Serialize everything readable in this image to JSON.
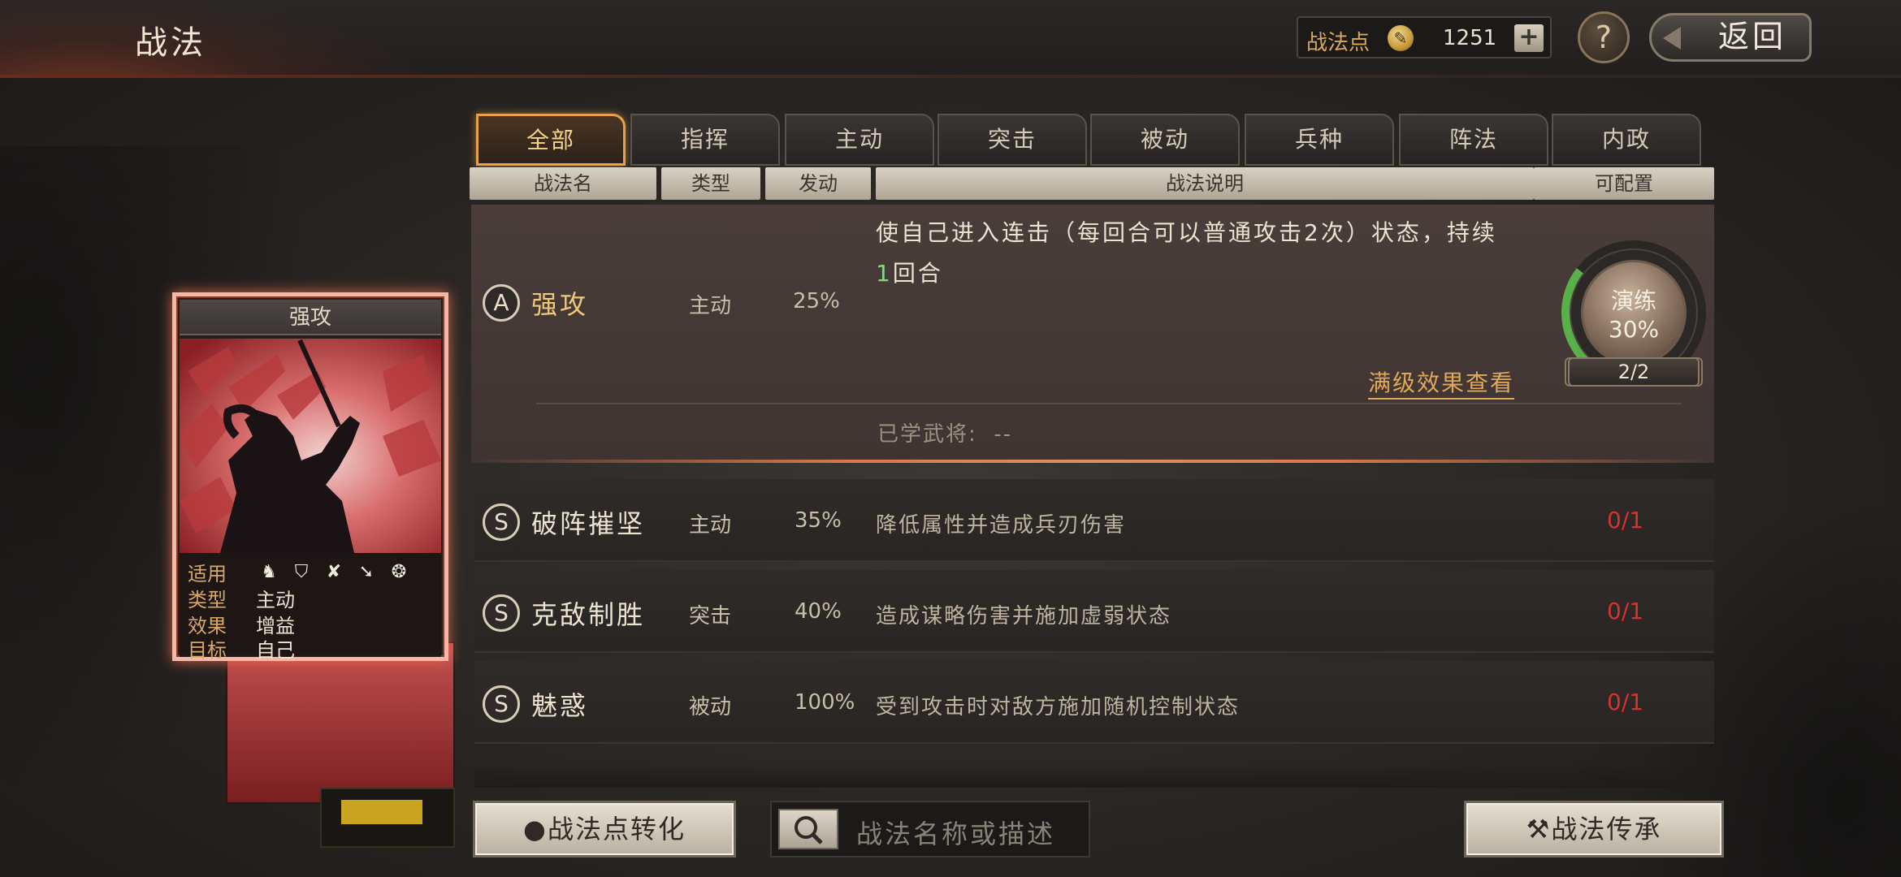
{
  "header": {
    "title": "战法",
    "points_label": "战法点",
    "points_value": "1251",
    "plus_label": "+",
    "help_label": "?",
    "back_label": "返回"
  },
  "card": {
    "title": "强攻",
    "applies_key": "适用",
    "type_key": "类型",
    "type_value": "主动",
    "effect_key": "效果",
    "effect_value": "增益",
    "target_key": "目标",
    "target_value": "自己",
    "troop_icons": [
      "cavalry-icon",
      "shield-icon",
      "archer-icon",
      "spear-icon",
      "wheel-icon"
    ]
  },
  "tabs": [
    "全部",
    "指挥",
    "主动",
    "突击",
    "被动",
    "兵种",
    "阵法",
    "内政"
  ],
  "columns": {
    "name": "战法名",
    "type": "类型",
    "trigger": "发动",
    "description": "战法说明",
    "configurable": "可配置"
  },
  "selected_skill": {
    "grade": "A",
    "name": "强攻",
    "type": "主动",
    "rate": "25%",
    "description_part1": "使自己进入连击（每回合可以普通攻击2次）状态，持续",
    "description_num": "1",
    "description_part2": "回合",
    "view_full": "满级效果查看",
    "learned_label": "已学武将:",
    "learned_value": "--",
    "practice_label": "演练",
    "practice_pct": "30%",
    "practice_count": "2/2",
    "practice_progress": 0.3
  },
  "skills": [
    {
      "grade": "S",
      "name": "破阵摧坚",
      "type": "主动",
      "rate": "35%",
      "description": "降低属性并造成兵刃伤害",
      "count": "0/1"
    },
    {
      "grade": "S",
      "name": "克敌制胜",
      "type": "突击",
      "rate": "40%",
      "description": "造成谋略伤害并施加虚弱状态",
      "count": "0/1"
    },
    {
      "grade": "S",
      "name": "魅惑",
      "type": "被动",
      "rate": "100%",
      "description": "受到攻击时对敌方施加随机控制状态",
      "count": "0/1"
    }
  ],
  "footer": {
    "convert_label": "战法点转化",
    "search_placeholder": "战法名称或描述",
    "inherit_label": "战法传承"
  },
  "colors": {
    "accent_gold": "#f0c87a",
    "tab_active_border": "#e8a04a",
    "count_red": "#d4342e",
    "progress_green": "#5ab048"
  }
}
